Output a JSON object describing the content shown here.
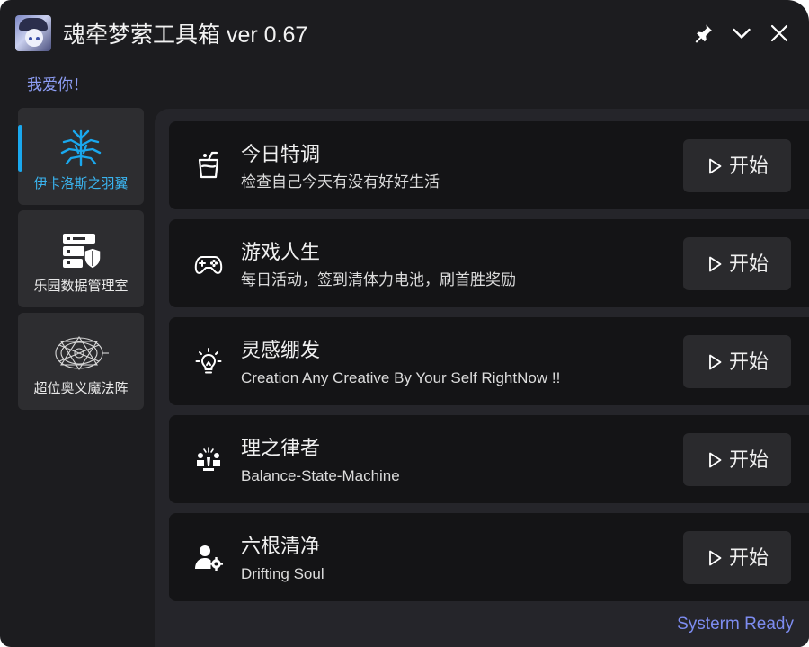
{
  "app": {
    "title": "魂牵梦萦工具箱 ver 0.67",
    "subtitle": "我爱你！",
    "status": "Systerm Ready"
  },
  "titlebar": {
    "pin_icon": "pin-icon",
    "minimize_icon": "chevron-down-icon",
    "close_icon": "close-icon"
  },
  "sidebar": {
    "items": [
      {
        "label": "伊卡洛斯之羽翼",
        "icon": "wings-icon",
        "active": true
      },
      {
        "label": "乐园数据管理室",
        "icon": "server-shield-icon",
        "active": false
      },
      {
        "label": "超位奥义魔法阵",
        "icon": "magic-circle-icon",
        "active": false
      }
    ]
  },
  "tools": [
    {
      "title": "今日特调",
      "description": "检查自己今天有没有好好生活",
      "icon": "drink-icon",
      "button": "开始"
    },
    {
      "title": "游戏人生",
      "description": "每日活动，签到清体力电池，刷首胜奖励",
      "icon": "gamepad-icon",
      "button": "开始"
    },
    {
      "title": "灵感绷发",
      "description": "Creation Any Creative By Your Self RightNow !!",
      "icon": "lightbulb-icon",
      "button": "开始"
    },
    {
      "title": "理之律者",
      "description": "Balance-State-Machine",
      "icon": "balance-icon",
      "button": "开始"
    },
    {
      "title": "六根清净",
      "description": "Drifting Soul",
      "icon": "user-gear-icon",
      "button": "开始"
    }
  ],
  "colors": {
    "accent": "#1aa8ee",
    "subtitle": "#8e9ef5",
    "status": "#7d8cf0",
    "window_bg": "#1c1c1f",
    "card_bg": "#141416"
  }
}
